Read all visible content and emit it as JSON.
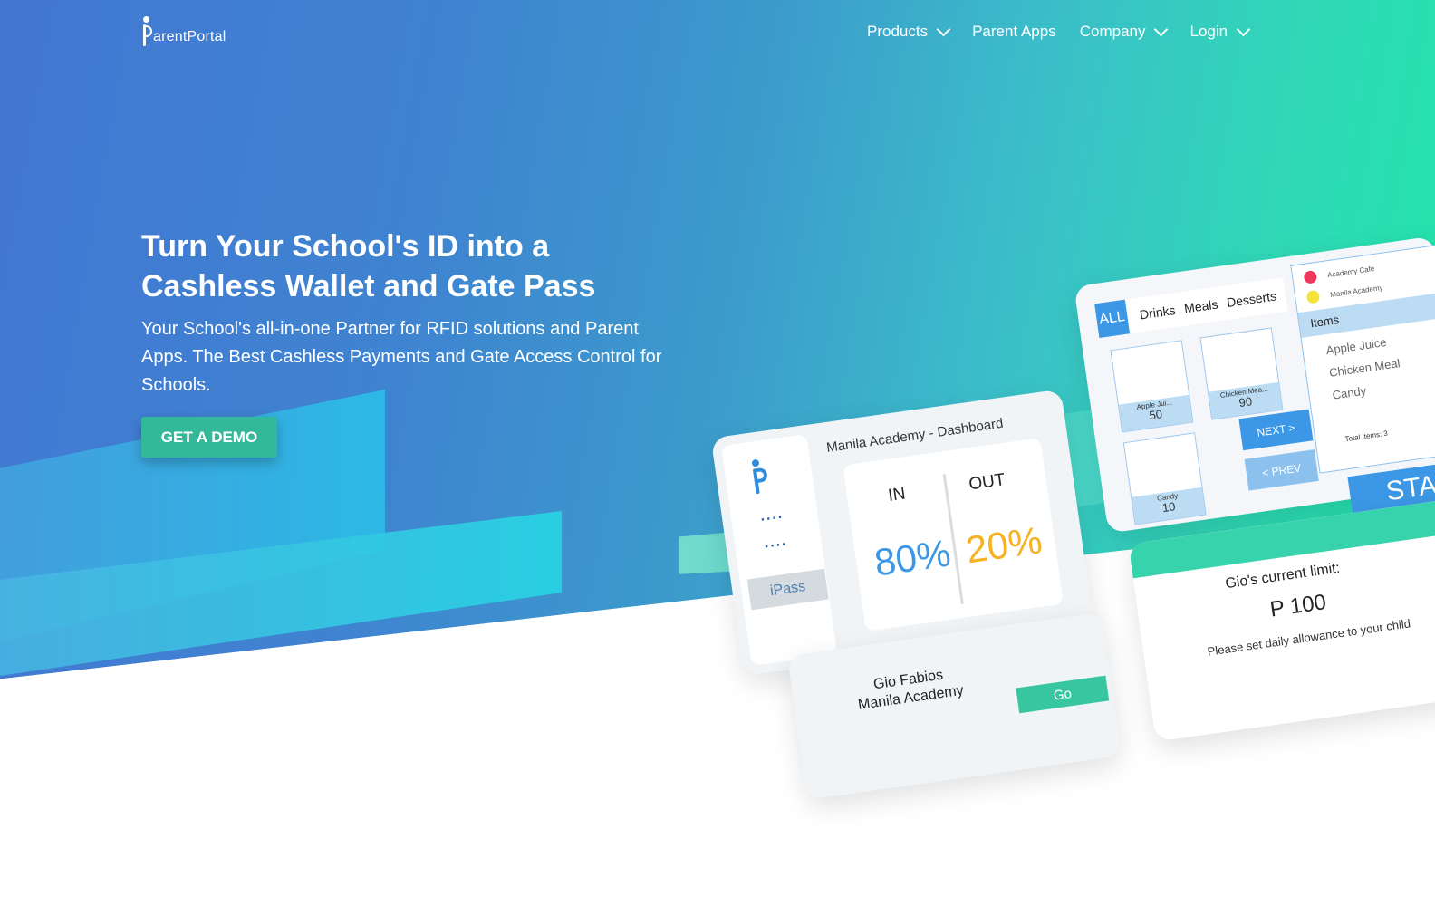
{
  "brand": {
    "logo_text": "arentPortal"
  },
  "nav": [
    {
      "label": "Products",
      "has_dropdown": true
    },
    {
      "label": "Parent Apps",
      "has_dropdown": false
    },
    {
      "label": "Company",
      "has_dropdown": true
    },
    {
      "label": "Login",
      "has_dropdown": true
    }
  ],
  "hero": {
    "title_line1": "Turn Your School's ID into a",
    "title_line2": "Cashless Wallet and Gate Pass",
    "subtitle": "Your School's all-in-one Partner for RFID solutions and Parent Apps. The Best Cashless Payments and Gate Access Control for Schools.",
    "cta_label": "GET A DEMO"
  },
  "mockup": {
    "dashboard": {
      "title": "Manila Academy - Dashboard",
      "side_dots": "....",
      "ipass_label": "iPass",
      "in_label": "IN",
      "in_value": "80%",
      "out_label": "OUT",
      "out_value": "20%"
    },
    "pos": {
      "tabs": [
        "ALL",
        "Drinks",
        "Meals",
        "Desserts"
      ],
      "tiles": [
        {
          "name": "Apple Jui...",
          "price": "50"
        },
        {
          "name": "Chicken Mea...",
          "price": "90"
        },
        {
          "name": "Candy",
          "price": "10"
        }
      ],
      "next_label": "NEXT >",
      "prev_label": "< PREV",
      "legend": [
        "Academy Cafe",
        "Manila Academy"
      ],
      "items_header": "Items",
      "items": [
        "Apple Juice",
        "Chicken Meal",
        "Candy"
      ],
      "total": "Total Items: 3",
      "start_label": "STA"
    },
    "profile": {
      "name": "Gio Fabios",
      "school": "Manila Academy",
      "go_label": "Go"
    },
    "limit": {
      "title": "Gio's current limit:",
      "value": "P 100",
      "note": "Please set daily allowance to your child"
    }
  },
  "colors": {
    "gradient_start": "#4277d3",
    "gradient_end": "#1fe6a9",
    "cta": "#33b89a",
    "accent_blue": "#3c98e6",
    "in_color": "#3c98e6",
    "out_color": "#f7b21f",
    "legend_red": "#f0385d",
    "legend_yellow": "#f6e33a"
  }
}
